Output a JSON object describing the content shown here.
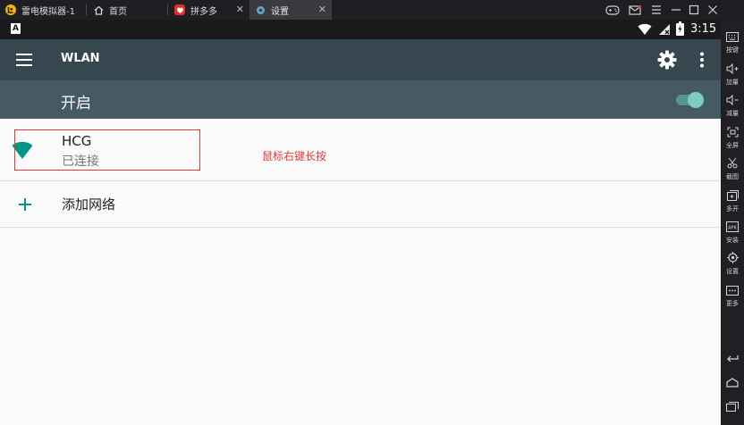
{
  "window": {
    "tabs": [
      {
        "label": "雷电模拟器-1",
        "icon": "ldplayer-logo-icon"
      },
      {
        "label": "首页",
        "icon": "home-icon"
      },
      {
        "label": "拼多多",
        "icon": "pinduoduo-app-icon"
      },
      {
        "label": "设置",
        "icon": "settings-app-icon"
      }
    ],
    "controls": [
      "gamepad-icon",
      "mail-icon",
      "menu-icon",
      "minimize-icon",
      "maximize-icon",
      "close-icon"
    ]
  },
  "statusbar": {
    "badge": "A",
    "time": "3:15"
  },
  "appbar": {
    "title": "WLAN"
  },
  "wifi_toggle": {
    "label": "开启",
    "on": true
  },
  "networks": [
    {
      "ssid": "HCG",
      "status": "已连接"
    }
  ],
  "annotation": {
    "text": "鼠标右键长按",
    "color": "#e53935"
  },
  "add_network": {
    "label": "添加网络"
  },
  "sidebar": {
    "items": [
      {
        "label": "按键",
        "icon": "keyboard-icon"
      },
      {
        "label": "加量",
        "icon": "volume-up-icon"
      },
      {
        "label": "减量",
        "icon": "volume-down-icon"
      },
      {
        "label": "全屏",
        "icon": "fullscreen-icon"
      },
      {
        "label": "截图",
        "icon": "scissors-icon"
      },
      {
        "label": "多开",
        "icon": "multi-instance-icon"
      },
      {
        "label": "安装",
        "icon": "apk-install-icon"
      },
      {
        "label": "设置",
        "icon": "settings-gear-icon"
      },
      {
        "label": "更多",
        "icon": "more-icon"
      }
    ],
    "nav": [
      "back-icon",
      "home-nav-icon",
      "recents-icon"
    ]
  },
  "colors": {
    "accent": "#009688",
    "appbar": "#37474f",
    "switchbar": "#455a64",
    "switch_thumb": "#80cbc4"
  }
}
